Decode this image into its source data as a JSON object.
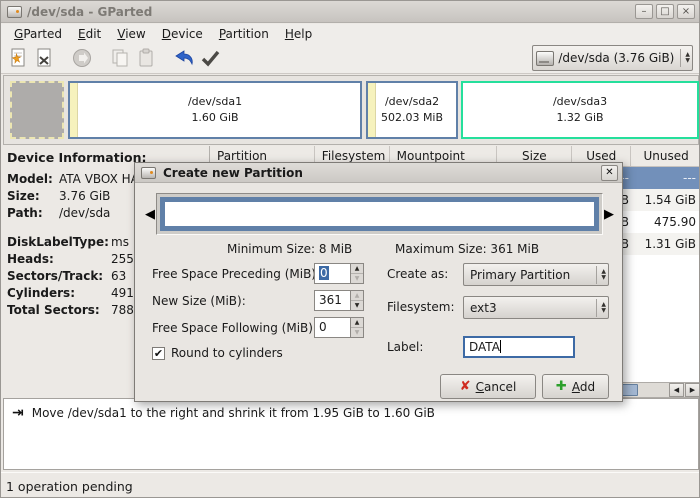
{
  "titlebar": {
    "title": "/dev/sda - GParted"
  },
  "icons": {
    "minimize": "–",
    "maximize": "□",
    "close": "×",
    "dialog_close": "✕",
    "combo_up": "▲",
    "combo_down": "▼",
    "spin_up": "▲",
    "spin_down": "▼",
    "slider_left": "◀",
    "slider_right": "▶",
    "scroll_left": "◀",
    "scroll_right": "▶",
    "checkmark": "✔",
    "cancel_x": "✘",
    "add_plus": "✚",
    "op_move": "⇥"
  },
  "menu": {
    "items": [
      {
        "label": "GParted"
      },
      {
        "label": "Edit"
      },
      {
        "label": "View"
      },
      {
        "label": "Device"
      },
      {
        "label": "Partition"
      },
      {
        "label": "Help"
      }
    ]
  },
  "toolbar": {
    "icon_names": [
      "new-partition",
      "delete-partition",
      "resize-move",
      "copy",
      "paste",
      "undo",
      "apply"
    ],
    "device_selector": {
      "value": "/dev/sda  (3.76 GiB)"
    }
  },
  "partition_bar": {
    "partitions": [
      {
        "name": "/dev/sda1",
        "size": "1.60 GiB"
      },
      {
        "name": "/dev/sda2",
        "size": "502.03 MiB"
      },
      {
        "name": "/dev/sda3",
        "size": "1.32 GiB"
      }
    ],
    "colors": {
      "partition_border": "#6080a8",
      "sda3_border": "#25df9c",
      "used_strip": "#f6f2bd"
    }
  },
  "device_info": {
    "title": "Device Information:",
    "rows": [
      {
        "label": "Model:",
        "value": "ATA VBOX HA"
      },
      {
        "label": "Size:",
        "value": "3.76 GiB"
      },
      {
        "label": "Path:",
        "value": "/dev/sda"
      }
    ],
    "rows2": [
      {
        "label": "DiskLabelType:",
        "value": "ms"
      },
      {
        "label": "Heads:",
        "value": "255"
      },
      {
        "label": "Sectors/Track:",
        "value": "63"
      },
      {
        "label": "Cylinders:",
        "value": "491"
      },
      {
        "label": "Total Sectors:",
        "value": "788"
      }
    ]
  },
  "table": {
    "columns": [
      "Partition",
      "Filesystem",
      "Mountpoint",
      "Size",
      "Used",
      "Unused"
    ],
    "rows": [
      {
        "used": "---",
        "unused": "---",
        "selected": true
      },
      {
        "used": "B",
        "unused": "1.54 GiB",
        "selected": false
      },
      {
        "used": "B",
        "unused": "475.90 MiB",
        "selected": false
      },
      {
        "used": "B",
        "unused": "1.31 GiB",
        "selected": false
      }
    ]
  },
  "dialog": {
    "title": "Create new Partition",
    "min_size": "Minimum Size: 8 MiB",
    "max_size": "Maximum Size: 361 MiB",
    "fields": {
      "free_space_preceding": {
        "label": "Free Space Preceding (MiB):",
        "value": "0"
      },
      "new_size": {
        "label": "New Size (MiB):",
        "value": "361"
      },
      "free_space_following": {
        "label": "Free Space Following (MiB):",
        "value": "0"
      },
      "round_to_cylinders": {
        "label": "Round to cylinders",
        "checked": true
      },
      "create_as": {
        "label": "Create as:",
        "value": "Primary Partition"
      },
      "filesystem": {
        "label": "Filesystem:",
        "value": "ext3"
      },
      "partition_label": {
        "label": "Label:",
        "value": "DATA"
      }
    },
    "buttons": {
      "cancel": "Cancel",
      "add": "Add"
    }
  },
  "operations": {
    "pending_op": "Move /dev/sda1 to the right and shrink it from 1.95 GiB to 1.60 GiB"
  },
  "statusbar": {
    "text": "1 operation pending"
  }
}
